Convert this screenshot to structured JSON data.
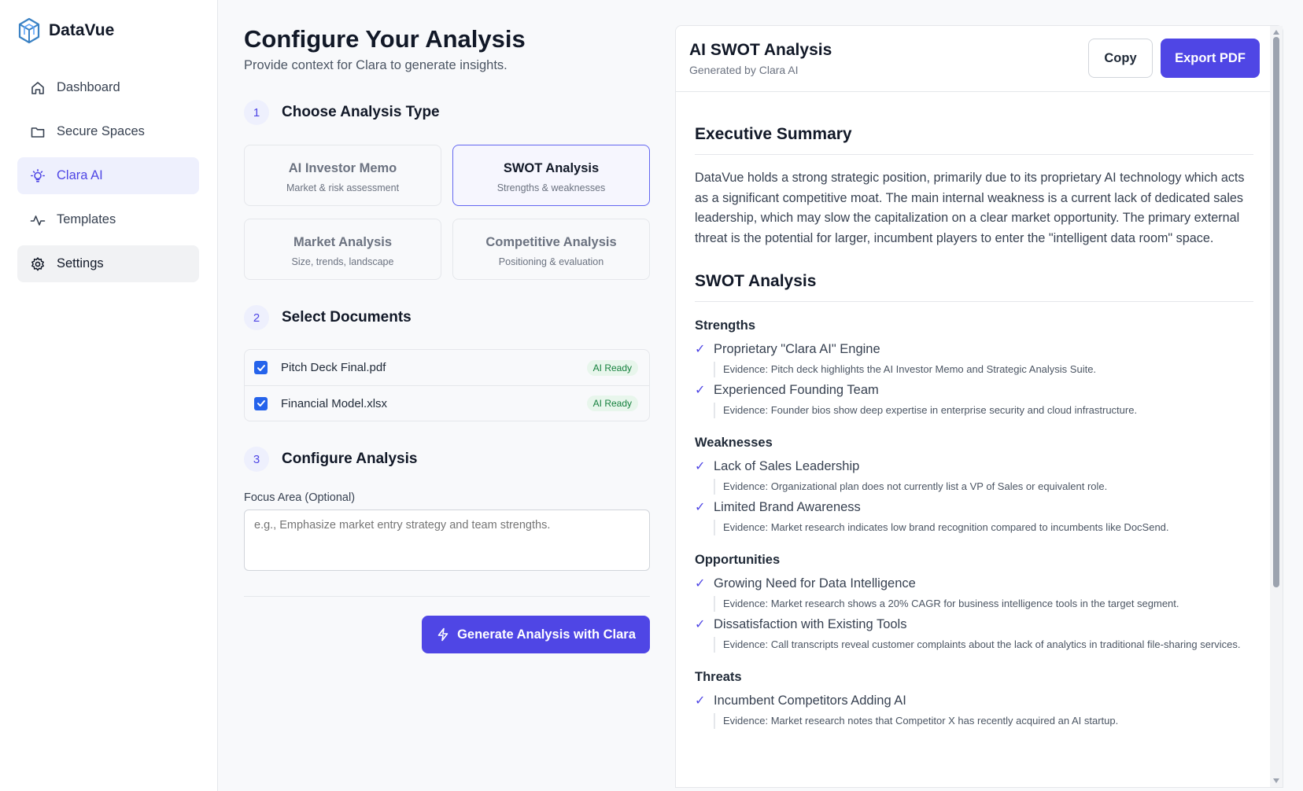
{
  "app": {
    "name": "DataVue"
  },
  "sidebar": {
    "items": [
      {
        "label": "Dashboard",
        "icon": "home-icon"
      },
      {
        "label": "Secure Spaces",
        "icon": "folder-icon"
      },
      {
        "label": "Clara AI",
        "icon": "lightbulb-icon",
        "state": "active"
      },
      {
        "label": "Templates",
        "icon": "templates-icon"
      },
      {
        "label": "Settings",
        "icon": "gear-icon",
        "state": "hover"
      }
    ]
  },
  "page": {
    "title": "Configure Your Analysis",
    "subtitle": "Provide context for Clara to generate insights."
  },
  "steps": [
    {
      "num": "1",
      "title": "Choose Analysis Type"
    },
    {
      "num": "2",
      "title": "Select Documents"
    },
    {
      "num": "3",
      "title": "Configure Analysis"
    }
  ],
  "analysis_types": [
    {
      "title": "AI Investor Memo",
      "desc": "Market & risk assessment",
      "selected": false
    },
    {
      "title": "SWOT Analysis",
      "desc": "Strengths & weaknesses",
      "selected": true
    },
    {
      "title": "Market Analysis",
      "desc": "Size, trends, landscape",
      "selected": false
    },
    {
      "title": "Competitive Analysis",
      "desc": "Positioning & evaluation",
      "selected": false
    }
  ],
  "documents": [
    {
      "name": "Pitch Deck Final.pdf",
      "badge": "AI Ready",
      "checked": true
    },
    {
      "name": "Financial Model.xlsx",
      "badge": "AI Ready",
      "checked": true
    }
  ],
  "focus": {
    "label": "Focus Area (Optional)",
    "placeholder": "e.g., Emphasize market entry strategy and team strengths.",
    "value": ""
  },
  "generate_label": "Generate Analysis with Clara",
  "report": {
    "title": "AI SWOT Analysis",
    "subtitle": "Generated by Clara AI",
    "copy_label": "Copy",
    "export_label": "Export PDF",
    "exec_heading": "Executive Summary",
    "exec_text": "DataVue holds a strong strategic position, primarily due to its proprietary AI technology which acts as a significant competitive moat. The main internal weakness is a current lack of dedicated sales leadership, which may slow the capitalization on a clear market opportunity. The primary external threat is the potential for larger, incumbent players to enter the \"intelligent data room\" space.",
    "swot_heading": "SWOT Analysis",
    "sections": [
      {
        "title": "Strengths",
        "items": [
          {
            "text": "Proprietary \"Clara AI\" Engine",
            "evidence": "Evidence: Pitch deck highlights the AI Investor Memo and Strategic Analysis Suite."
          },
          {
            "text": "Experienced Founding Team",
            "evidence": "Evidence: Founder bios show deep expertise in enterprise security and cloud infrastructure."
          }
        ]
      },
      {
        "title": "Weaknesses",
        "items": [
          {
            "text": "Lack of Sales Leadership",
            "evidence": "Evidence: Organizational plan does not currently list a VP of Sales or equivalent role."
          },
          {
            "text": "Limited Brand Awareness",
            "evidence": "Evidence: Market research indicates low brand recognition compared to incumbents like DocSend."
          }
        ]
      },
      {
        "title": "Opportunities",
        "items": [
          {
            "text": "Growing Need for Data Intelligence",
            "evidence": "Evidence: Market research shows a 20% CAGR for business intelligence tools in the target segment."
          },
          {
            "text": "Dissatisfaction with Existing Tools",
            "evidence": "Evidence: Call transcripts reveal customer complaints about the lack of analytics in traditional file-sharing services."
          }
        ]
      },
      {
        "title": "Threats",
        "items": [
          {
            "text": "Incumbent Competitors Adding AI",
            "evidence": "Evidence: Market research notes that Competitor X has recently acquired an AI startup."
          }
        ]
      }
    ]
  },
  "colors": {
    "accent": "#4f46e5",
    "active_nav_bg": "#eef0fd",
    "badge_green": "#15803d",
    "checkbox": "#2563eb"
  }
}
